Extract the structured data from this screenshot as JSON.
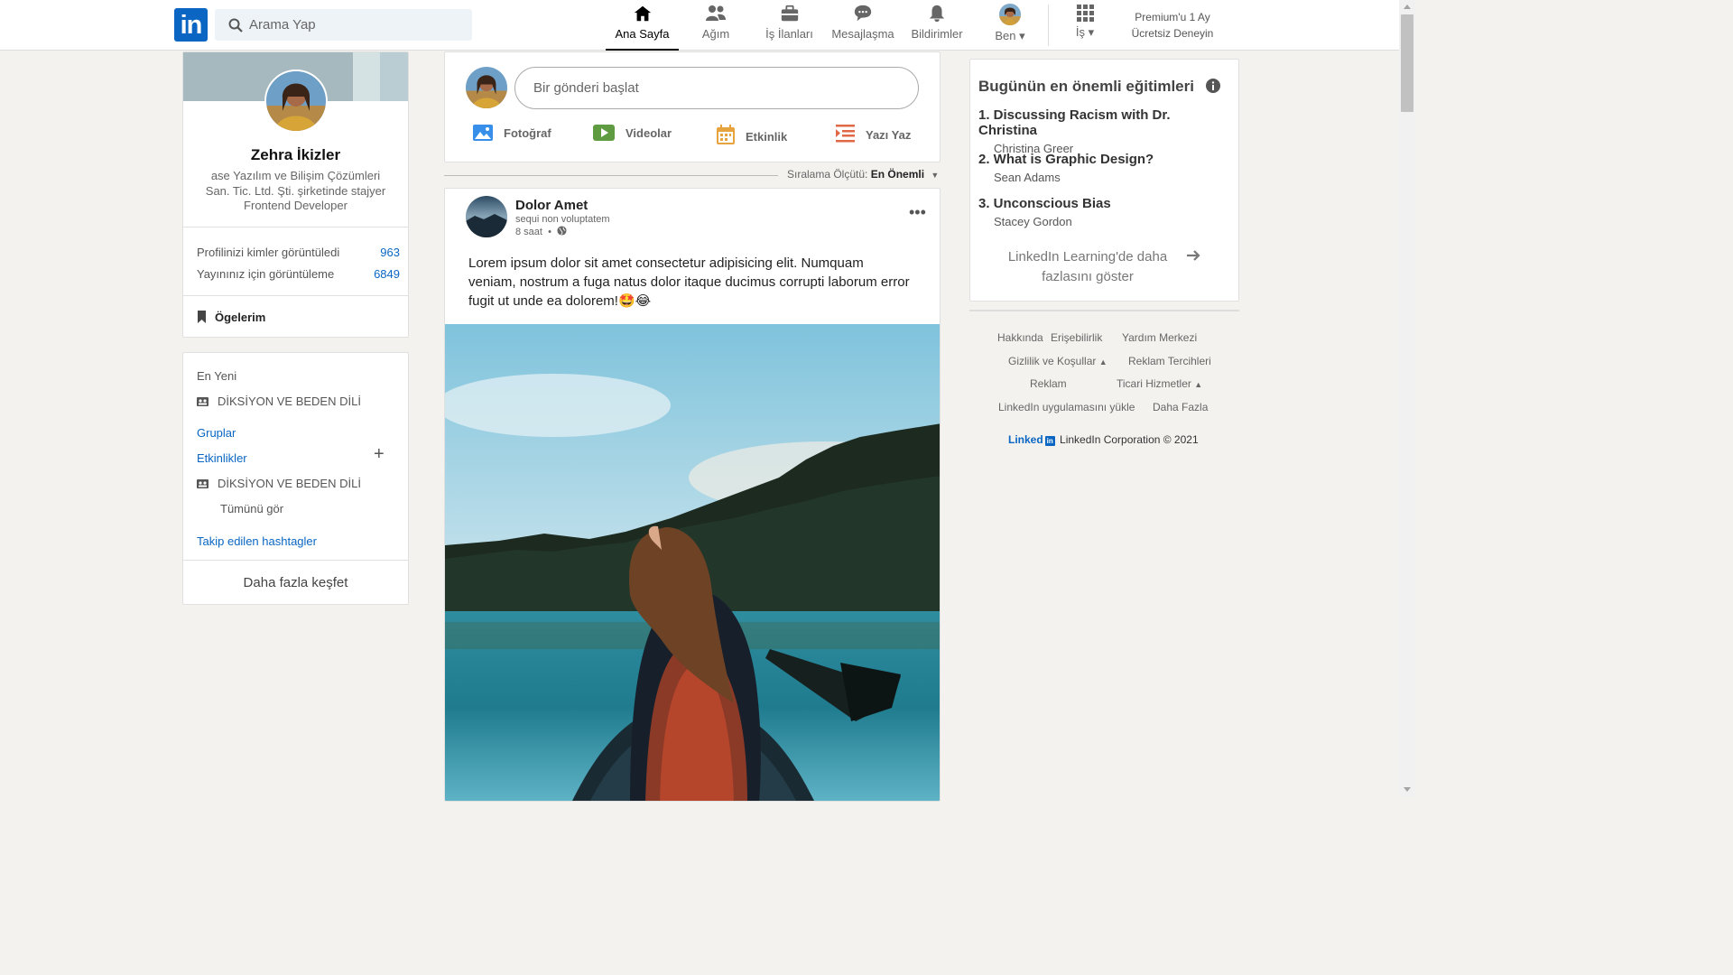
{
  "header": {
    "logo_text": "in",
    "search": {
      "placeholder": "Arama Yap"
    },
    "nav": [
      {
        "label": "Ana Sayfa",
        "icon": "home-icon",
        "active": true
      },
      {
        "label": "Ağım",
        "icon": "network-icon"
      },
      {
        "label": "İş İlanları",
        "icon": "briefcase-icon"
      },
      {
        "label": "Mesajlaşma",
        "icon": "message-icon"
      },
      {
        "label": "Bildirimler",
        "icon": "bell-icon"
      },
      {
        "label": "Ben",
        "icon": "avatar"
      },
      {
        "label": "İş",
        "icon": "grid-icon"
      }
    ],
    "premium": {
      "line1": "Premium'u 1 Ay",
      "line2": "Ücretsiz Deneyin"
    }
  },
  "profile": {
    "name": "Zehra İkizler",
    "description": "ase Yazılım ve Bilişim Çözümleri San. Tic. Ltd. Şti. şirketinde stajyer Frontend Developer",
    "stats": [
      {
        "label": "Profilinizi kimler görüntüledi",
        "value": "963"
      },
      {
        "label": "Yayınınız için görüntüleme",
        "value": "6849"
      }
    ],
    "items_label": "Ögelerim"
  },
  "groups": {
    "recent_label": "En Yeni",
    "recent_item": "DİKSİYON VE BEDEN DİLİ",
    "groups_link": "Gruplar",
    "events_link": "Etkinlikler",
    "event_item": "DİKSİYON VE BEDEN DİLİ",
    "see_all": "Tümünü gör",
    "hashtags_link": "Takip edilen hashtagler",
    "discover": "Daha fazla keşfet"
  },
  "share": {
    "placeholder": "Bir gönderi başlat",
    "buttons": [
      {
        "label": "Fotoğraf",
        "icon": "photo-icon",
        "color": "#378fe9"
      },
      {
        "label": "Videolar",
        "icon": "video-icon",
        "color": "#5f9b41"
      },
      {
        "label": "Etkinlik",
        "icon": "calendar-icon",
        "color": "#c37d16"
      },
      {
        "label": "Yazı Yaz",
        "icon": "article-icon",
        "color": "#e06847"
      }
    ]
  },
  "sort": {
    "label": "Sıralama Ölçütü:",
    "value": "En Önemli"
  },
  "post": {
    "author": "Dolor Amet",
    "subtitle": "sequi non voluptatem",
    "time": "8 saat",
    "text": "Lorem ipsum dolor sit amet consectetur adipisicing elit. Numquam veniam, nostrum a fuga natus dolor itaque ducimus corrupti laborum error fugit ut unde ea dolorem!🤩😂",
    "more": "•••"
  },
  "learning": {
    "title": "Bugünün en önemli eğitimleri",
    "courses": [
      {
        "title": "1. Discussing Racism with Dr. Christina",
        "author": "Christina Greer"
      },
      {
        "title": "2. What is Graphic Design?",
        "author": "Sean Adams"
      },
      {
        "title": "3. Unconscious Bias",
        "author": "Stacey Gordon"
      }
    ],
    "more": "LinkedIn Learning'de daha fazlasını göster"
  },
  "footer": {
    "links": [
      "Hakkında",
      "Erişebilirlik",
      "Yardım Merkezi",
      "Gizlilik ve Koşullar",
      "Reklam Tercihleri",
      "Reklam",
      "Ticari Hizmetler",
      "LinkedIn uygulamasını yükle",
      "Daha Fazla"
    ],
    "brand_word": "Linked",
    "brand_in": "in",
    "copyright": "LinkedIn Corporation © 2021"
  }
}
